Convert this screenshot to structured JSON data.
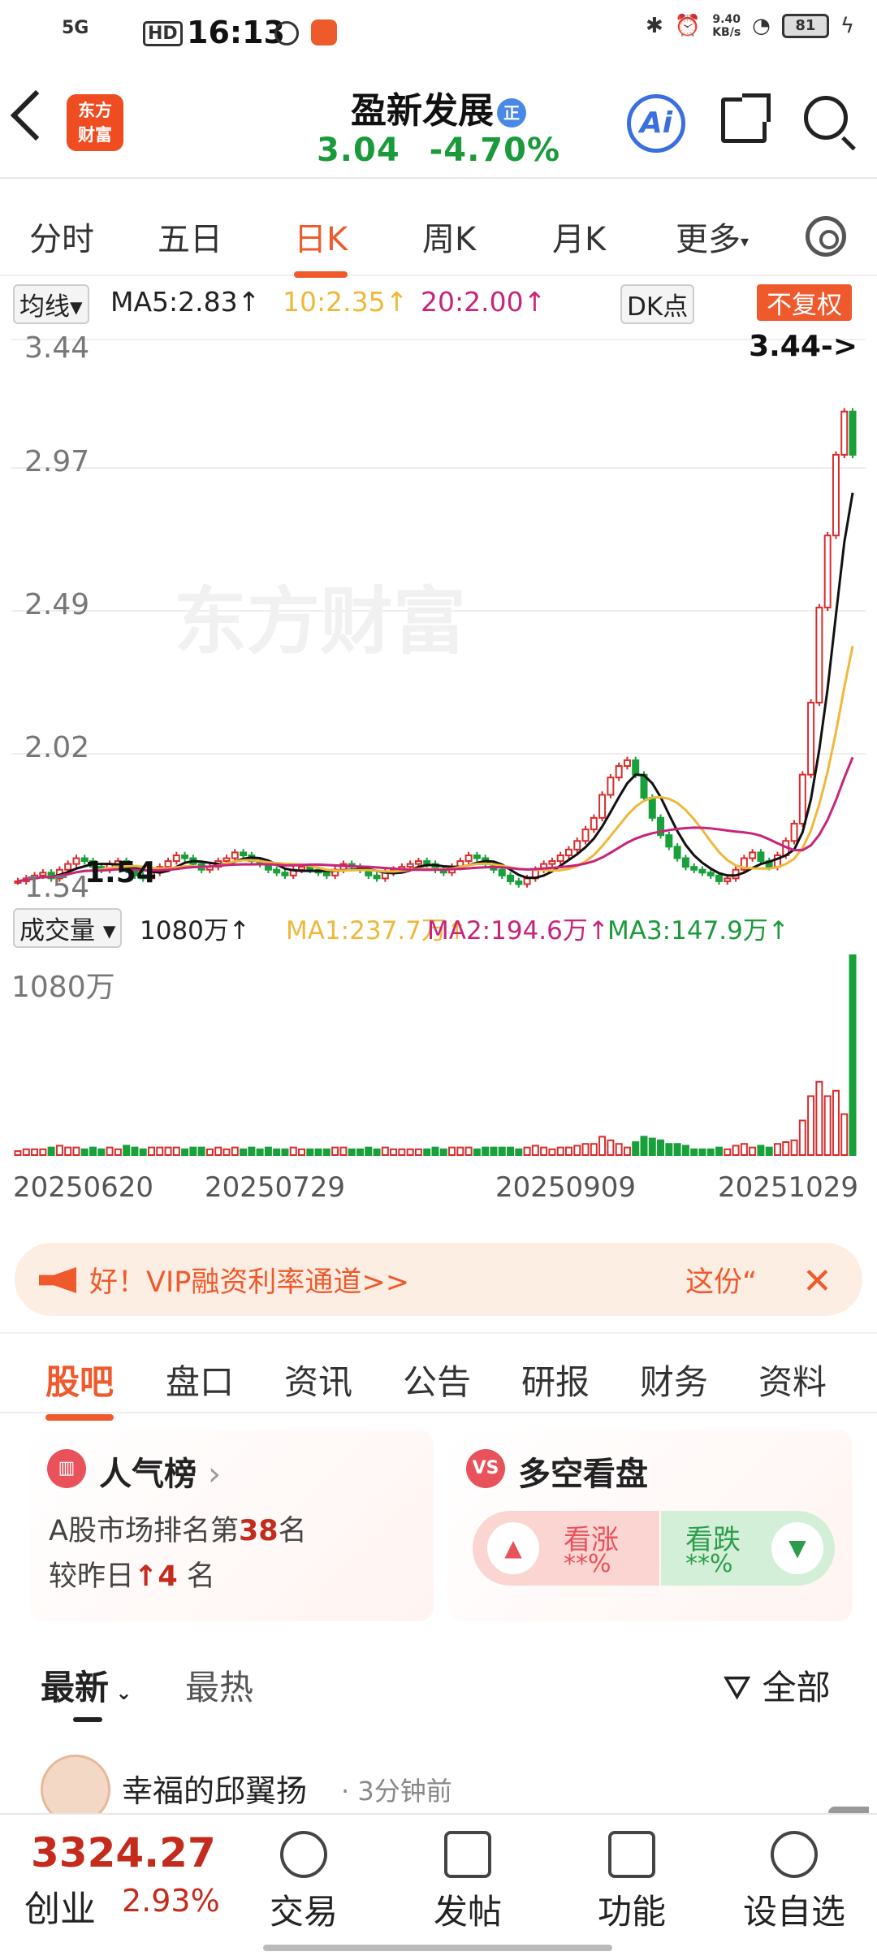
{
  "status": {
    "time": "16:13",
    "signal": "5G",
    "hd": "HD",
    "net_speed": "9.40\nKB/s",
    "battery": "81"
  },
  "header": {
    "back_icon": "chevron-left-icon",
    "logo_line1": "东方",
    "logo_line2": "财富",
    "title": "盈新发展",
    "badge": "正",
    "price": "3.04",
    "change_pct": "-4.70%",
    "ai_label": "Ai",
    "price_color": "#1a9a3a"
  },
  "ktabs": [
    {
      "label": "分时"
    },
    {
      "label": "五日"
    },
    {
      "label": "日K"
    },
    {
      "label": "周K"
    },
    {
      "label": "月K"
    },
    {
      "label": "更多"
    }
  ],
  "ma": {
    "selector": "均线",
    "ma5": "MA5:2.83",
    "ma10": "10:2.35",
    "ma20": "20:2.00",
    "dk": "DK点",
    "fq": "不复权",
    "up": "↑"
  },
  "price_axis": {
    "labels": [
      "3.44",
      "2.97",
      "2.49",
      "2.02",
      "1.54"
    ],
    "current": "3.44->",
    "low_marker": "1.54",
    "watermark": "东方财富"
  },
  "volume": {
    "selector": "成交量",
    "vol": "1080万",
    "ma1": "MA1:237.7万",
    "ma2": "MA2:194.6万",
    "ma3": "MA3:147.9万",
    "axis_max": "1080万"
  },
  "x_axis": [
    "20250620",
    "20250729",
    "20250909",
    "20251029"
  ],
  "banner": {
    "text": "好！VIP融资利率通道>>",
    "right": "这份“"
  },
  "subtabs": [
    {
      "label": "股吧"
    },
    {
      "label": "盘口"
    },
    {
      "label": "资讯"
    },
    {
      "label": "公告"
    },
    {
      "label": "研报"
    },
    {
      "label": "财务"
    },
    {
      "label": "资料"
    }
  ],
  "popularity": {
    "title": "人气榜",
    "line1_pre": "A股市场排名第",
    "rank": "38",
    "line1_post": "名",
    "line2_pre": "较昨日",
    "arrow": "↑",
    "change": "4",
    "line2_post": "名"
  },
  "bullbear": {
    "title": "多空看盘",
    "badge": "VS",
    "up_label": "看涨",
    "up_val": "**%",
    "down_label": "看跌",
    "down_val": "**%"
  },
  "feed": {
    "tab_latest": "最新",
    "tab_hot": "最热",
    "filter": "全部",
    "user": "幸福的邱翼扬",
    "time": "3分钟前"
  },
  "bottom": {
    "index_value": "3324.27",
    "index_name": "创业",
    "index_pct": "2.93%",
    "nav": [
      "交易",
      "发帖",
      "功能",
      "设自选"
    ]
  },
  "chart_data": {
    "type": "candlestick",
    "price_ticks": [
      3.44,
      2.97,
      2.49,
      2.02,
      1.54
    ],
    "ylim": [
      1.54,
      3.44
    ],
    "x_ticks": [
      "20250620",
      "20250729",
      "20250909",
      "20251029"
    ],
    "close": [
      1.56,
      1.57,
      1.58,
      1.59,
      1.57,
      1.6,
      1.62,
      1.64,
      1.63,
      1.61,
      1.6,
      1.62,
      1.63,
      1.6,
      1.58,
      1.57,
      1.59,
      1.61,
      1.63,
      1.65,
      1.64,
      1.62,
      1.6,
      1.61,
      1.63,
      1.64,
      1.66,
      1.65,
      1.63,
      1.62,
      1.6,
      1.59,
      1.58,
      1.6,
      1.61,
      1.6,
      1.59,
      1.58,
      1.6,
      1.62,
      1.61,
      1.6,
      1.58,
      1.57,
      1.59,
      1.6,
      1.61,
      1.62,
      1.63,
      1.62,
      1.6,
      1.59,
      1.61,
      1.63,
      1.65,
      1.64,
      1.62,
      1.6,
      1.58,
      1.56,
      1.55,
      1.57,
      1.6,
      1.62,
      1.63,
      1.65,
      1.67,
      1.7,
      1.74,
      1.78,
      1.86,
      1.92,
      1.96,
      1.98,
      1.93,
      1.85,
      1.78,
      1.72,
      1.68,
      1.64,
      1.61,
      1.6,
      1.59,
      1.58,
      1.56,
      1.57,
      1.6,
      1.64,
      1.66,
      1.63,
      1.61,
      1.65,
      1.7,
      1.76,
      1.93,
      2.18,
      2.51,
      2.76,
      3.04,
      3.19,
      3.04
    ],
    "volume_max": "1080万",
    "volume_last": "1080万",
    "ma_lines": [
      "MA5:2.83",
      "10:2.35",
      "20:2.00"
    ]
  }
}
